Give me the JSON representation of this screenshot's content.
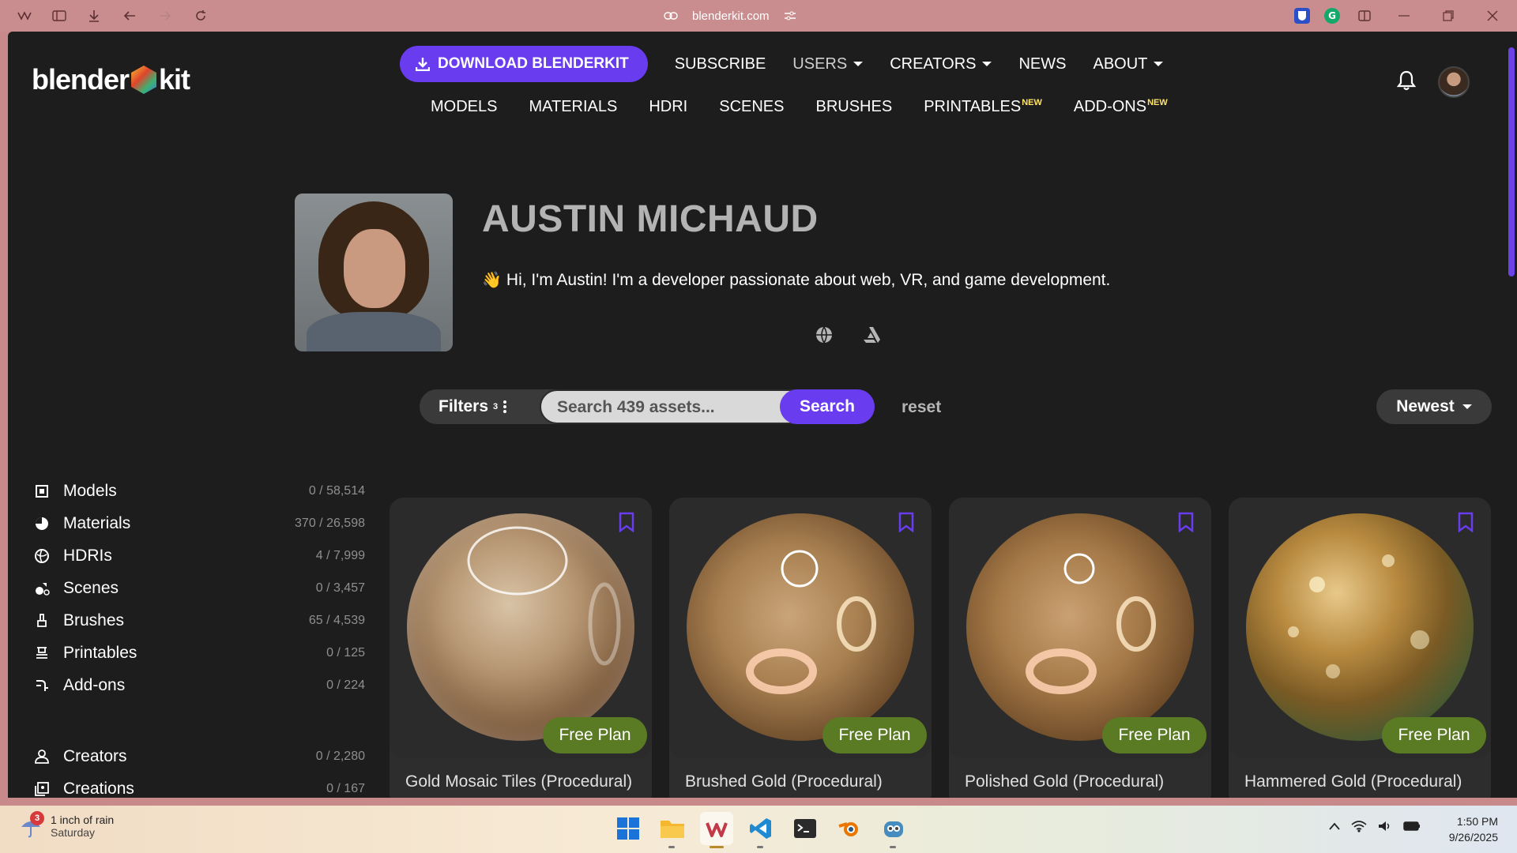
{
  "browser": {
    "url": "blenderkit.com"
  },
  "logo": {
    "left": "blender",
    "right": "kit"
  },
  "topnav": {
    "download": "DOWNLOAD BLENDERKIT",
    "subscribe": "SUBSCRIBE",
    "users": "USERS",
    "creators": "CREATORS",
    "news": "NEWS",
    "about": "ABOUT"
  },
  "subnav": {
    "items": [
      "MODELS",
      "MATERIALS",
      "HDRI",
      "SCENES",
      "BRUSHES",
      "PRINTABLES",
      "ADD-ONS"
    ],
    "new_badge": "NEW"
  },
  "profile": {
    "name": "AUSTIN MICHAUD",
    "bio": "Hi, I'm Austin! I'm a developer passionate about web, VR, and game development."
  },
  "search": {
    "filters_label": "Filters",
    "filters_count": "3",
    "placeholder": "Search 439 assets...",
    "button": "Search",
    "reset": "reset",
    "sort": "Newest"
  },
  "sidebar": {
    "items": [
      {
        "label": "Models",
        "count": "0 / 58,514"
      },
      {
        "label": "Materials",
        "count": "370 / 26,598"
      },
      {
        "label": "HDRIs",
        "count": "4 / 7,999"
      },
      {
        "label": "Scenes",
        "count": "0 / 3,457"
      },
      {
        "label": "Brushes",
        "count": "65 / 4,539"
      },
      {
        "label": "Printables",
        "count": "0 / 125"
      },
      {
        "label": "Add-ons",
        "count": "0 / 224"
      },
      {
        "label": "Creators",
        "count": "0 / 2,280"
      },
      {
        "label": "Creations",
        "count": "0 / 167"
      }
    ]
  },
  "cards": [
    {
      "title": "Gold Mosaic Tiles (Procedural)",
      "plan": "Free Plan"
    },
    {
      "title": "Brushed Gold (Procedural)",
      "plan": "Free Plan"
    },
    {
      "title": "Polished Gold (Procedural)",
      "plan": "Free Plan"
    },
    {
      "title": "Hammered Gold (Procedural)",
      "plan": "Free Plan"
    }
  ],
  "taskbar": {
    "weather_badge": "3",
    "weather_line1": "1 inch of rain",
    "weather_line2": "Saturday",
    "time": "1:50 PM",
    "date": "9/26/2025"
  },
  "colors": {
    "accent": "#6a3cf0",
    "plan_green": "#5a7a23",
    "page_bg": "#1d1d1d",
    "chrome_bg": "#c98d8f"
  }
}
